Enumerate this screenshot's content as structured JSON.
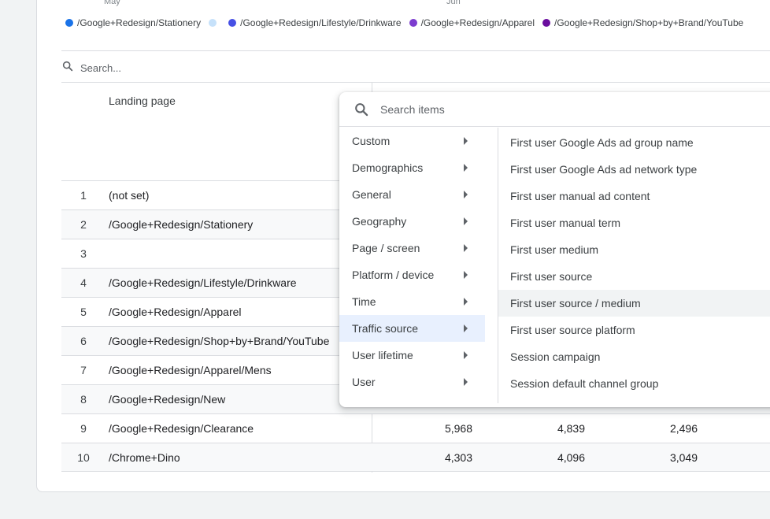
{
  "axis": {
    "month1": "May",
    "month2": "Jun"
  },
  "legend": [
    {
      "label": "/Google+Redesign/Stationery",
      "color": "#1a73e8"
    },
    {
      "label": "",
      "color": "#c6e1fa"
    },
    {
      "label": "/Google+Redesign/Lifestyle/Drinkware",
      "color": "#4650e5"
    },
    {
      "label": "/Google+Redesign/Apparel",
      "color": "#7c3ccf"
    },
    {
      "label": "/Google+Redesign/Shop+by+Brand/YouTube",
      "color": "#6a0d9e"
    }
  ],
  "table_search": {
    "placeholder": "Search..."
  },
  "table": {
    "column_header": "Landing page",
    "rows": [
      {
        "num": "1",
        "page": "(not set)",
        "m1": "",
        "m2": "",
        "m3": ""
      },
      {
        "num": "2",
        "page": "/Google+Redesign/Stationery",
        "m1": "",
        "m2": "",
        "m3": ""
      },
      {
        "num": "3",
        "page": "",
        "m1": "",
        "m2": "",
        "m3": ""
      },
      {
        "num": "4",
        "page": "/Google+Redesign/Lifestyle/Drinkware",
        "m1": "",
        "m2": "",
        "m3": ""
      },
      {
        "num": "5",
        "page": "/Google+Redesign/Apparel",
        "m1": "",
        "m2": "",
        "m3": ""
      },
      {
        "num": "6",
        "page": "/Google+Redesign/Shop+by+Brand/YouTube",
        "m1": "",
        "m2": "",
        "m3": ""
      },
      {
        "num": "7",
        "page": "/Google+Redesign/Apparel/Mens",
        "m1": "",
        "m2": "",
        "m3": ""
      },
      {
        "num": "8",
        "page": "/Google+Redesign/New",
        "m1": "",
        "m2": "",
        "m3": ""
      },
      {
        "num": "9",
        "page": "/Google+Redesign/Clearance",
        "m1": "5,968",
        "m2": "4,839",
        "m3": "2,496"
      },
      {
        "num": "10",
        "page": "/Chrome+Dino",
        "m1": "4,303",
        "m2": "4,096",
        "m3": "3,049"
      }
    ]
  },
  "menu": {
    "search_placeholder": "Search items",
    "categories": [
      "Custom",
      "Demographics",
      "General",
      "Geography",
      "Page / screen",
      "Platform / device",
      "Time",
      "Traffic source",
      "User lifetime",
      "User"
    ],
    "active_category": "Traffic source",
    "subitems": [
      "First user Google Ads ad group name",
      "First user Google Ads ad network type",
      "First user manual ad content",
      "First user manual term",
      "First user medium",
      "First user source",
      "First user source / medium",
      "First user source platform",
      "Session campaign",
      "Session default channel group"
    ],
    "hovered_subitem": "First user source / medium"
  },
  "icons": {
    "search": "search-icon",
    "submenu": "caret-right-icon"
  }
}
